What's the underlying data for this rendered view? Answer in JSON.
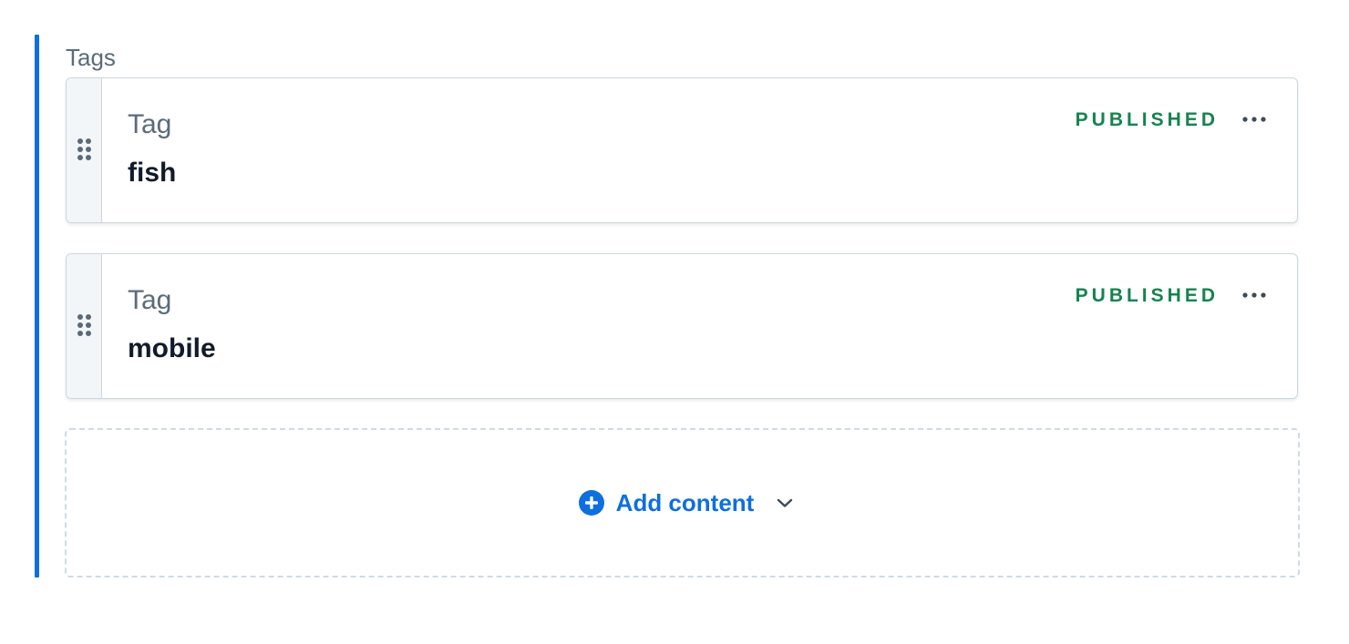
{
  "field": {
    "label": "Tags"
  },
  "entries": [
    {
      "content_type": "Tag",
      "title": "fish",
      "status": "PUBLISHED"
    },
    {
      "content_type": "Tag",
      "title": "mobile",
      "status": "PUBLISHED"
    }
  ],
  "add_content": {
    "label": "Add content"
  },
  "colors": {
    "accent": "#0e6fdf",
    "published": "#16834f",
    "text_muted": "#5a6b7d",
    "text_strong": "#111b2b"
  },
  "icons": {
    "drag": "drag-handle-icon",
    "more": "more-options-icon",
    "add": "plus-circle-icon",
    "chevron": "chevron-down-icon"
  }
}
